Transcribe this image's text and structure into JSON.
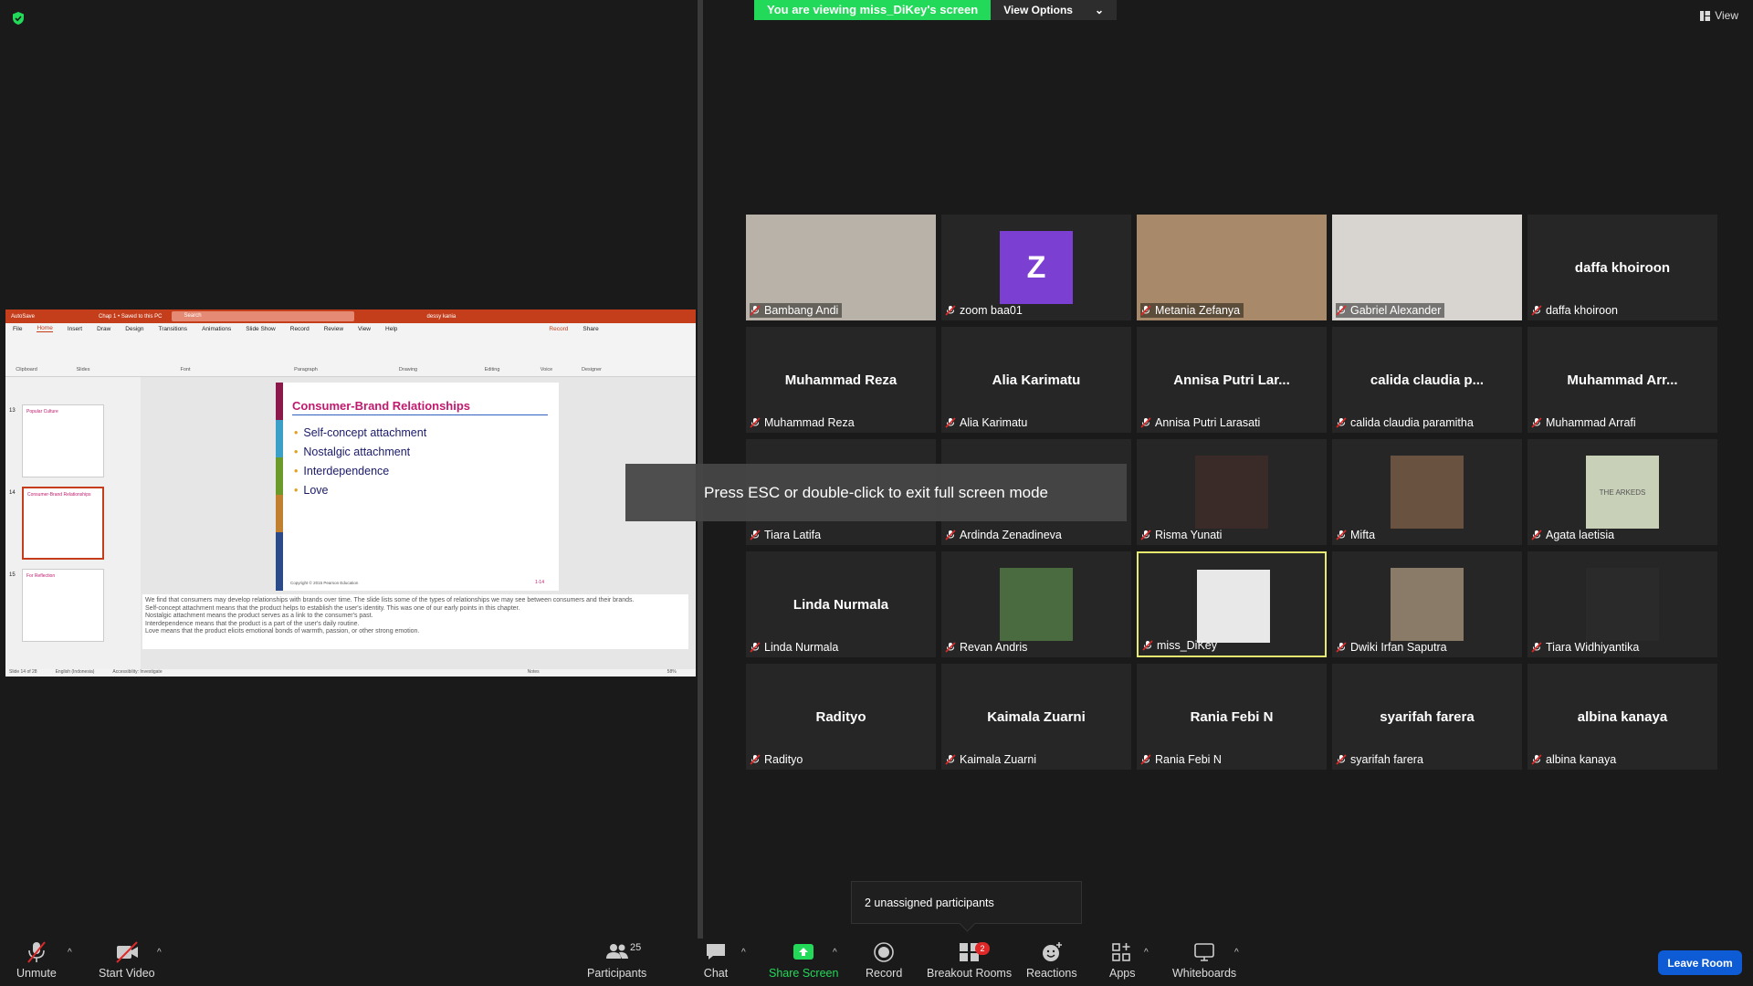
{
  "banner": {
    "viewing": "You are viewing miss_DiKey's screen",
    "options": "View Options"
  },
  "view_label": "View",
  "toast": "Press ESC or double-click to exit full screen mode",
  "unassigned": "2 unassigned participants",
  "shared_screen": {
    "titlebar": {
      "autosave": "AutoSave",
      "filename": "Chap 1 • Saved to this PC",
      "search": "Search",
      "user": "dessy kania"
    },
    "tabs": [
      "File",
      "Home",
      "Insert",
      "Draw",
      "Design",
      "Transitions",
      "Animations",
      "Slide Show",
      "Record",
      "Review",
      "View",
      "Help"
    ],
    "ribbon_groups": [
      "Clipboard",
      "Slides",
      "Font",
      "Paragraph",
      "Drawing",
      "Editing",
      "Voice",
      "Designer"
    ],
    "record_btn": "Record",
    "share_btn": "Share",
    "slide": {
      "title": "Consumer-Brand Relationships",
      "bullets": [
        "Self-concept attachment",
        "Nostalgic attachment",
        "Interdependence",
        "Love"
      ],
      "footer": "Copyright © 2015 Pearson Education",
      "page": "1-14"
    },
    "thumb_numbers": [
      "13",
      "14",
      "15"
    ],
    "thumb_titles": [
      "Popular Culture",
      "Consumer-Brand Relationships",
      "For Reflection"
    ],
    "notes": [
      "We find that consumers may develop relationships with brands over time. The slide lists some of the types of relationships we may see between consumers and their brands.",
      "Self-concept attachment means that the product helps to establish the user's identity. This was one of our early points in this chapter.",
      "Nostalgic attachment means the product serves as a link to the consumer's past.",
      "Interdependence means that the product is a part of the user's daily routine.",
      "Love means that the product elicits emotional bonds of warmth, passion, or other strong emotion."
    ],
    "status": {
      "slide": "Slide 14 of 28",
      "lang": "English (Indonesia)",
      "access": "Accessibility: Investigate",
      "notes": "Notes",
      "zoom": "58%"
    }
  },
  "participants": [
    {
      "name": "Bambang Andi",
      "display": "",
      "type": "cam",
      "cam_color": "#b9b2a8"
    },
    {
      "name": "zoom baa01",
      "display": "Z",
      "type": "avatar"
    },
    {
      "name": "Metania Zefanya",
      "display": "",
      "type": "cam",
      "cam_color": "#a88a6a"
    },
    {
      "name": "Gabriel Alexander",
      "display": "",
      "type": "cam",
      "cam_color": "#d8d4d0"
    },
    {
      "name": "daffa khoiroon",
      "display": "daffa khoiroon",
      "type": "name"
    },
    {
      "name": "Muhammad Reza",
      "display": "Muhammad Reza",
      "type": "name"
    },
    {
      "name": "Alia Karimatu",
      "display": "Alia Karimatu",
      "type": "name"
    },
    {
      "name": "Annisa Putri Larasati",
      "display": "Annisa Putri Lar...",
      "type": "name"
    },
    {
      "name": "calida claudia paramitha",
      "display": "calida claudia p...",
      "type": "name"
    },
    {
      "name": "Muhammad Arrafi",
      "display": "Muhammad Arr...",
      "type": "name"
    },
    {
      "name": "Tiara Latifa",
      "display": "",
      "type": "name"
    },
    {
      "name": "Ardinda Zenadineva",
      "display": "",
      "type": "name"
    },
    {
      "name": "Risma Yunati",
      "display": "",
      "type": "photo",
      "cam_color": "#3a2a28"
    },
    {
      "name": "Mifta",
      "display": "",
      "type": "photo",
      "cam_color": "#6a5240"
    },
    {
      "name": "Agata laetisia",
      "display": "THE ARKEDS",
      "type": "photo",
      "cam_color": "#c8d0b8"
    },
    {
      "name": "Linda Nurmala",
      "display": "Linda Nurmala",
      "type": "name"
    },
    {
      "name": "Revan Andris",
      "display": "",
      "type": "photo",
      "cam_color": "#4a6a40"
    },
    {
      "name": "miss_DiKey",
      "display": "",
      "type": "photo",
      "cam_color": "#e8e8e8",
      "active": true
    },
    {
      "name": "Dwiki Irfan Saputra",
      "display": "",
      "type": "photo",
      "cam_color": "#8a7a68"
    },
    {
      "name": "Tiara Widhiyantika",
      "display": "",
      "type": "photo",
      "cam_color": "#2a2a2a"
    },
    {
      "name": "Radityo",
      "display": "Radityo",
      "type": "name"
    },
    {
      "name": "Kaimala Zuarni",
      "display": "Kaimala Zuarni",
      "type": "name"
    },
    {
      "name": "Rania Febi N",
      "display": "Rania Febi N",
      "type": "name"
    },
    {
      "name": "syarifah farera",
      "display": "syarifah farera",
      "type": "name"
    },
    {
      "name": "albina kanaya",
      "display": "albina kanaya",
      "type": "name"
    }
  ],
  "toolbar": {
    "unmute": "Unmute",
    "start_video": "Start Video",
    "participants": "Participants",
    "participants_count": "25",
    "chat": "Chat",
    "share_screen": "Share Screen",
    "record": "Record",
    "breakout_rooms": "Breakout Rooms",
    "breakout_badge": "2",
    "reactions": "Reactions",
    "apps": "Apps",
    "whiteboards": "Whiteboards",
    "leave": "Leave Room"
  },
  "colors": {
    "accent_green": "#23d959",
    "leave_blue": "#0e5bd6",
    "active_border": "#e6ea6e",
    "mute_red": "#e02828"
  }
}
